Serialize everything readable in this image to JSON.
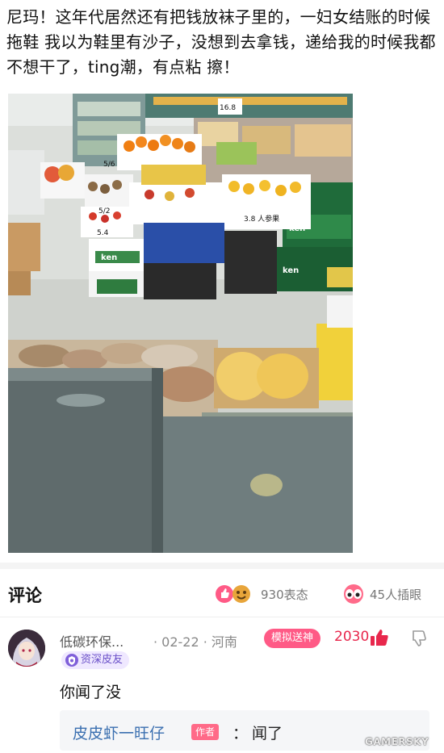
{
  "post": {
    "text": "尼玛！这年代居然还有把钱放袜子里的，一妇女结账的时候拖鞋 我以为鞋里有沙子，没想到去拿钱，递给我的时候我都不想干了，ting潮，有点粘 擦！",
    "photo_labels": {
      "tag_1": "5/6",
      "tag_2": "5/2",
      "tag_3": "5.4",
      "tag_4": "3.8 人参果",
      "tag_5": "16.8",
      "box_1": "ken",
      "box_2": "ken",
      "box_3": "ken"
    }
  },
  "comments_header": {
    "title": "评论",
    "reactions_count": "930表态",
    "collect_count": "45人插眼"
  },
  "comment": {
    "username": "低碳环保...",
    "date_location": "· 02-22 · 河南",
    "badge": "模拟送神",
    "likes": "2030",
    "level": "资深皮友",
    "body": "你闻了没",
    "reply": {
      "author": "皮皮虾一旺仔",
      "author_tag": "作者",
      "colon": "：",
      "text": "闻了"
    }
  },
  "watermark": "GAMERSKY",
  "colors": {
    "accent_pink": "#ff5a86",
    "likes_red": "#e8274c",
    "reply_blue": "#3a6fb0",
    "level_purple": "#6a50c8"
  },
  "icons": {
    "reaction": "thumbs-up-face-icon",
    "collect": "eyes-icon",
    "like": "thumbs-up-icon",
    "dislike": "thumbs-down-icon",
    "level": "shield-badge-icon"
  }
}
